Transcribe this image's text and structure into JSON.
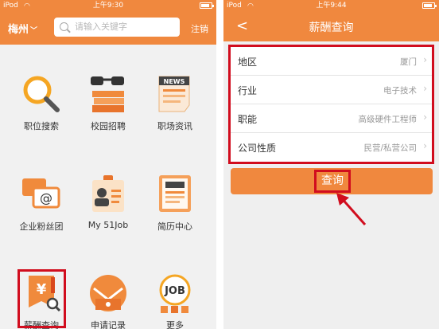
{
  "left_screen": {
    "status": {
      "carrier": "iPod",
      "time": "上午9:30"
    },
    "header": {
      "city": "梅州",
      "search_placeholder": "请输入关键字",
      "logout": "注销"
    },
    "menu": [
      {
        "label": "职位搜索",
        "icon": "magnifier-icon"
      },
      {
        "label": "校园招聘",
        "icon": "books-glasses-icon"
      },
      {
        "label": "职场资讯",
        "icon": "news-icon",
        "icon_text": "NEWS"
      },
      {
        "label": "企业粉丝团",
        "icon": "chat-at-icon"
      },
      {
        "label": "My 51Job",
        "icon": "id-card-icon"
      },
      {
        "label": "简历中心",
        "icon": "resume-icon"
      },
      {
        "label": "薪酬查询",
        "icon": "salary-icon",
        "icon_text": "¥"
      },
      {
        "label": "申请记录",
        "icon": "envelope-icon"
      },
      {
        "label": "更多",
        "icon": "job-more-icon",
        "icon_text": "JOB"
      }
    ]
  },
  "right_screen": {
    "status": {
      "carrier": "iPod",
      "time": "上午9:44"
    },
    "title": "薪酬查询",
    "form": {
      "rows": [
        {
          "label": "地区",
          "value": "厦门"
        },
        {
          "label": "行业",
          "value": "电子技术"
        },
        {
          "label": "职能",
          "value": "高级硬件工程师"
        },
        {
          "label": "公司性质",
          "value": "民营/私营公司"
        }
      ]
    },
    "query_button": "查询"
  },
  "colors": {
    "accent": "#f0883e",
    "highlight": "#d10d1e"
  }
}
